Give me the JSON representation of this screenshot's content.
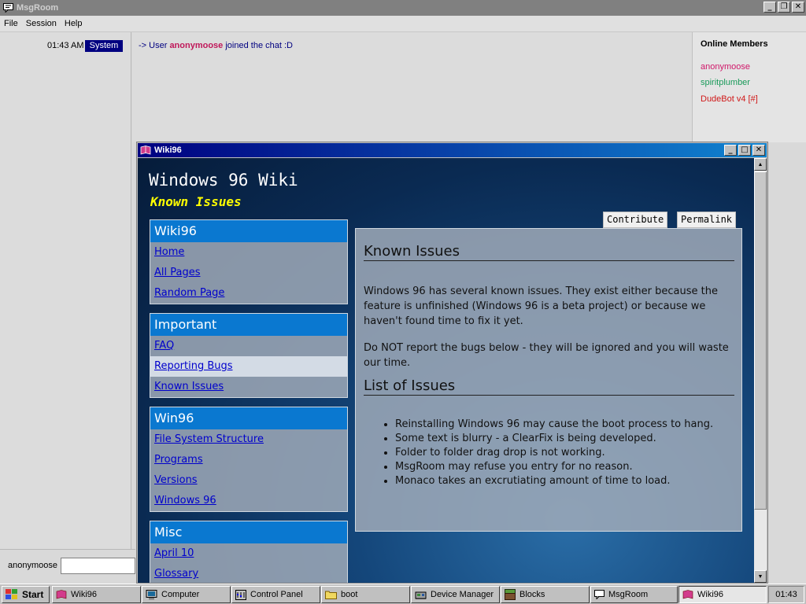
{
  "msgroom": {
    "title": "MsgRoom",
    "menu": [
      "File",
      "Session",
      "Help"
    ],
    "log": {
      "time": "01:43 AM",
      "badge": "System",
      "prefix": "-> User",
      "user": "anonymoose",
      "suffix": "joined the chat :D"
    },
    "members": {
      "header": "Online Members",
      "list": [
        {
          "name": "anonymoose",
          "color": "#d0186a"
        },
        {
          "name": "spiritplumber",
          "color": "#1a9a5a"
        },
        {
          "name": "DudeBot v4 [#]",
          "color": "#d01818"
        }
      ]
    },
    "input": {
      "nick": "anonymoose",
      "value": ""
    }
  },
  "wiki": {
    "window_title": "Wiki96",
    "site_title": "Windows 96 Wiki",
    "page_subtitle": "Known Issues",
    "contribute_label": "Contribute",
    "permalink_label": "Permalink",
    "nav": [
      {
        "header": "Wiki96",
        "links": [
          "Home",
          "All Pages",
          "Random Page"
        ]
      },
      {
        "header": "Important",
        "links": [
          "FAQ",
          "Reporting Bugs",
          "Known Issues"
        ]
      },
      {
        "header": "Win96",
        "links": [
          "File System Structure",
          "Programs",
          "Versions",
          "Windows 96"
        ]
      },
      {
        "header": "Misc",
        "links": [
          "April 10",
          "Glossary"
        ]
      }
    ],
    "article": {
      "heading": "Known Issues",
      "para1": "Windows 96 has several known issues. They exist either because the feature is unfinished (Windows 96 is a beta project) or because we haven't found time to fix it yet.",
      "para2": "Do NOT report the bugs below - they will be ignored and you will waste our time.",
      "list_heading": "List of Issues",
      "issues": [
        "Reinstalling Windows 96 may cause the boot process to hang.",
        "Some text is blurry - a ClearFix is being developed.",
        "Folder to folder drag drop is not working.",
        "MsgRoom may refuse you entry for no reason.",
        "Monaco takes an excrutiating amount of time to load."
      ]
    }
  },
  "taskbar": {
    "start": "Start",
    "items": [
      "Wiki96",
      "Computer",
      "Control Panel",
      "boot",
      "Device Manager",
      "Blocks",
      "MsgRoom",
      "Wiki96"
    ],
    "clock": "01:43"
  }
}
